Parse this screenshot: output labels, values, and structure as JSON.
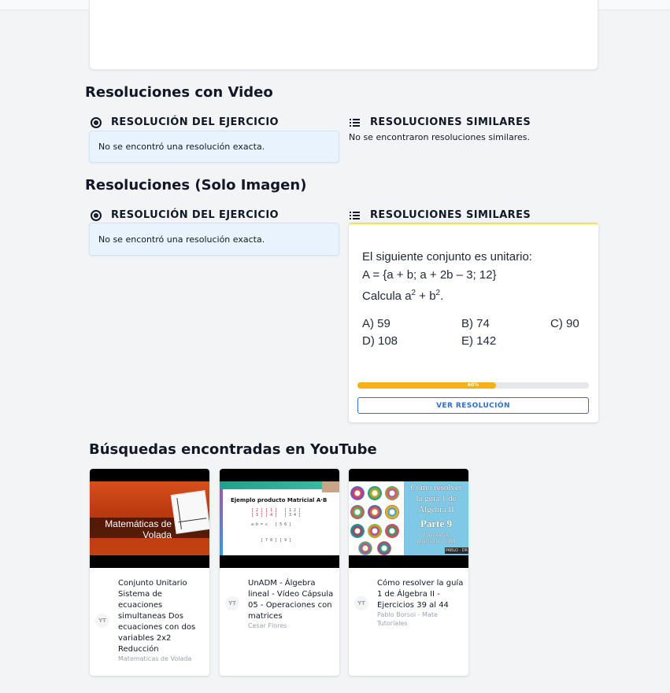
{
  "sections": {
    "video": {
      "title": "Resoluciones con Video",
      "exact_heading": "RESOLUCIÓN DEL EJERCICIO",
      "exact_message": "No se encontró una resolución exacta.",
      "similar_heading": "RESOLUCIONES SIMILARES",
      "similar_message": "No se encontraron resoluciones similares."
    },
    "image": {
      "title": "Resoluciones (Solo Imagen)",
      "exact_heading": "RESOLUCIÓN DEL EJERCICIO",
      "exact_message": "No se encontró una resolución exacta.",
      "similar_heading": "RESOLUCIONES SIMILARES",
      "similar_card": {
        "problem_line1": "El siguiente conjunto es unitario:",
        "problem_line2": "A = {a + b; a + 2b – 3; 12}",
        "problem_line3_prefix": "Calcula a",
        "problem_line3_exp1": "2",
        "problem_line3_mid": " + b",
        "problem_line3_exp2": "2",
        "problem_line3_suffix": ".",
        "options": [
          "A) 59",
          "B) 74",
          "C) 90",
          "D) 108",
          "E) 142"
        ],
        "match_percent": 60,
        "match_label": "60%",
        "button_label": "VER RESOLUCIÓN"
      }
    }
  },
  "youtube": {
    "title": "Búsquedas encontradas en YouTube",
    "badge": "YT",
    "videos": [
      {
        "title": "Conjunto Unitario Sistema de ecuaciones simultaneas Dos ecuaciones con dos variables 2x2 Reducción",
        "channel": "Matematicas de Volada",
        "thumb_text_line1": "Matemáticas de",
        "thumb_text_line2": "Volada"
      },
      {
        "title": "UnADM - Álgebra lineal - Vídeo Cápsula 05 - Operaciones con matrices",
        "channel": "Cesar Flores",
        "thumb_heading": "Ejemplo producto Matricial A·B"
      },
      {
        "title": "Cómo resolver la guía 1 de Álgebra II - Ejercicios 39 al 44",
        "channel": "Pablo Borsoi - Mate Tutoriales",
        "thumb_line1": "Cómo resolver",
        "thumb_line2": "la guía 1 de",
        "thumb_line3": "Álgebra II",
        "thumb_line4": "Parte 9",
        "thumb_line5": "Facultad de",
        "thumb_line6": "Ingeniería - UBA",
        "thumb_tag": "PABLO · DR"
      }
    ]
  },
  "colors": {
    "info_bg": "#e8f3fd",
    "progress": "#f2b114",
    "button": "#2f6fd6",
    "card_accent": "#fde047"
  }
}
